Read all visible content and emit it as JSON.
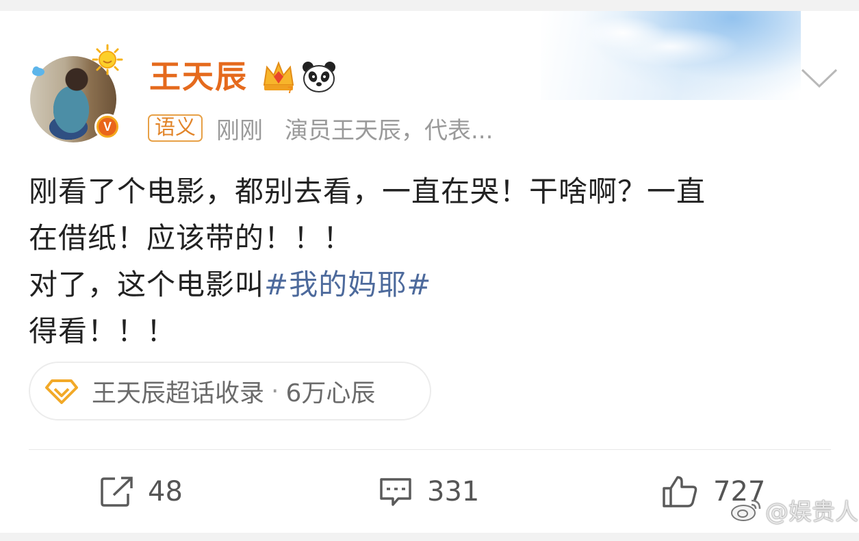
{
  "post": {
    "username": "王天辰",
    "badge_tag": "语义",
    "time": "刚刚",
    "bio": "演员王天辰，代表...",
    "verified_mark": "V",
    "body": {
      "line1": "刚看了个电影，都别去看，一直在哭！干啥啊？一直",
      "line2": "在借纸！应该带的！！！",
      "line3_prefix": "对了，这个电影叫",
      "hashtag": "#我的妈耶#",
      "line4": "得看！！！"
    },
    "supertopic": {
      "label": "王天辰超话收录",
      "separator": "·",
      "fans": "6万心辰"
    },
    "actions": {
      "repost_count": "48",
      "comment_count": "331",
      "like_count": "727"
    },
    "watermark": "@娱贵人"
  },
  "colors": {
    "username": "#e56a1d",
    "hashtag": "#4d6a9c",
    "tag_border": "#e7a046",
    "verified": "#f4a81e"
  },
  "icons": {
    "avatar_decor": [
      "sun-icon",
      "cloud-icon"
    ],
    "username_badges": [
      "crown-icon",
      "panda-icon"
    ],
    "menu": "chevron-down-icon",
    "supertopic": "diamond-icon",
    "actions": [
      "repost-icon",
      "comment-icon",
      "like-icon"
    ],
    "watermark": "weibo-logo-icon"
  }
}
